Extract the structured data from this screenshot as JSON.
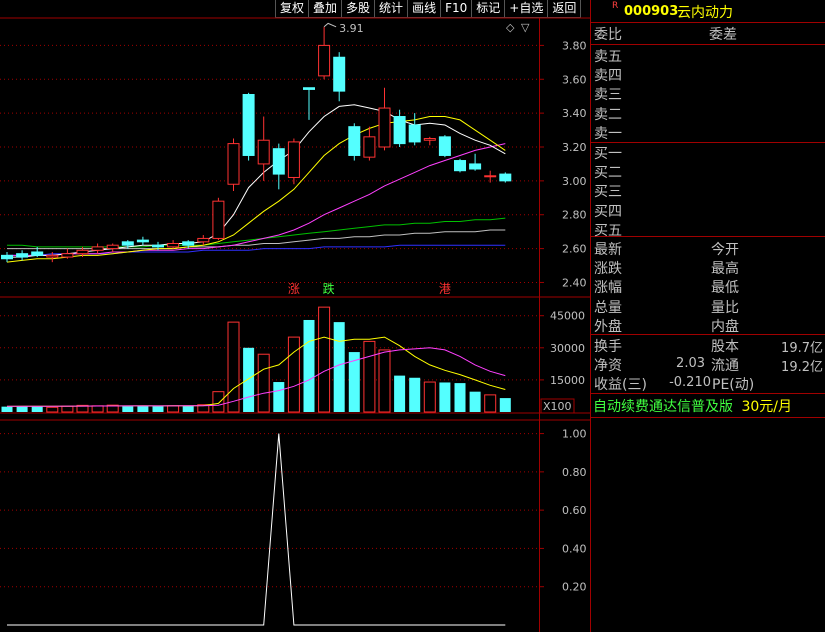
{
  "toolbar": {
    "buttons": [
      "复权",
      "叠加",
      "多股",
      "统计",
      "画线",
      "F10",
      "标记",
      "+自选",
      "返回"
    ]
  },
  "stock": {
    "marker": "R",
    "code": "000903",
    "name": "云内动力"
  },
  "order_book": {
    "committee_ratio": "委比",
    "committee_diff": "委差",
    "sell_levels": [
      "卖五",
      "卖四",
      "卖三",
      "卖二",
      "卖一"
    ],
    "buy_levels": [
      "买一",
      "买二",
      "买三",
      "买四",
      "买五"
    ]
  },
  "quote": {
    "left": [
      "最新",
      "涨跌",
      "涨幅",
      "总量",
      "外盘"
    ],
    "right": [
      "今开",
      "最高",
      "最低",
      "量比",
      "内盘"
    ]
  },
  "fundamentals": {
    "turnover_label": "换手",
    "share_capital_label": "股本",
    "share_capital_value": "19.7亿",
    "net_assets_label": "净资",
    "net_assets_value": "2.03",
    "float_label": "流通",
    "float_value": "19.2亿",
    "eps_label": "收益(三)",
    "eps_value": "-0.210",
    "pe_label": "PE(动)"
  },
  "ad": {
    "text": "自动续费通达信普及版",
    "price": "30元/月"
  },
  "chart_data": [
    {
      "type": "candlestick",
      "y_ticks": [
        "3.80",
        "3.60",
        "3.40",
        "3.20",
        "3.00",
        "2.80",
        "2.60",
        "2.40"
      ],
      "ylim": [
        2.32,
        3.95
      ],
      "max_label": "3.91",
      "event_labels": [
        "涨",
        "跌",
        "港"
      ],
      "candles": [
        {
          "o": 2.56,
          "h": 2.58,
          "l": 2.52,
          "c": 2.54,
          "up": false
        },
        {
          "o": 2.55,
          "h": 2.59,
          "l": 2.53,
          "c": 2.57,
          "up": false
        },
        {
          "o": 2.58,
          "h": 2.61,
          "l": 2.55,
          "c": 2.56,
          "up": false
        },
        {
          "o": 2.56,
          "h": 2.58,
          "l": 2.52,
          "c": 2.55,
          "up": true
        },
        {
          "o": 2.55,
          "h": 2.6,
          "l": 2.54,
          "c": 2.57,
          "up": true
        },
        {
          "o": 2.57,
          "h": 2.61,
          "l": 2.55,
          "c": 2.59,
          "up": true
        },
        {
          "o": 2.59,
          "h": 2.63,
          "l": 2.57,
          "c": 2.61,
          "up": true
        },
        {
          "o": 2.6,
          "h": 2.63,
          "l": 2.58,
          "c": 2.62,
          "up": true
        },
        {
          "o": 2.62,
          "h": 2.65,
          "l": 2.6,
          "c": 2.64,
          "up": false
        },
        {
          "o": 2.64,
          "h": 2.67,
          "l": 2.62,
          "c": 2.65,
          "up": false
        },
        {
          "o": 2.62,
          "h": 2.64,
          "l": 2.59,
          "c": 2.61,
          "up": false
        },
        {
          "o": 2.61,
          "h": 2.65,
          "l": 2.6,
          "c": 2.63,
          "up": true
        },
        {
          "o": 2.62,
          "h": 2.65,
          "l": 2.6,
          "c": 2.64,
          "up": false
        },
        {
          "o": 2.64,
          "h": 2.68,
          "l": 2.62,
          "c": 2.66,
          "up": true
        },
        {
          "o": 2.66,
          "h": 2.9,
          "l": 2.65,
          "c": 2.88,
          "up": true
        },
        {
          "o": 2.98,
          "h": 3.25,
          "l": 2.94,
          "c": 3.22,
          "up": true
        },
        {
          "o": 3.15,
          "h": 3.52,
          "l": 3.12,
          "c": 3.51,
          "up": false
        },
        {
          "o": 3.1,
          "h": 3.38,
          "l": 3.0,
          "c": 3.24,
          "up": true
        },
        {
          "o": 3.04,
          "h": 3.22,
          "l": 2.95,
          "c": 3.19,
          "up": false
        },
        {
          "o": 3.02,
          "h": 3.25,
          "l": 2.98,
          "c": 3.23,
          "up": true
        },
        {
          "o": 3.55,
          "h": 3.55,
          "l": 3.36,
          "c": 3.54,
          "up": false
        },
        {
          "o": 3.62,
          "h": 3.91,
          "l": 3.6,
          "c": 3.8,
          "up": true
        },
        {
          "o": 3.73,
          "h": 3.76,
          "l": 3.47,
          "c": 3.53,
          "up": false
        },
        {
          "o": 3.32,
          "h": 3.34,
          "l": 3.12,
          "c": 3.15,
          "up": false
        },
        {
          "o": 3.14,
          "h": 3.32,
          "l": 3.12,
          "c": 3.26,
          "up": true
        },
        {
          "o": 3.2,
          "h": 3.55,
          "l": 3.18,
          "c": 3.43,
          "up": true
        },
        {
          "o": 3.38,
          "h": 3.42,
          "l": 3.2,
          "c": 3.22,
          "up": false
        },
        {
          "o": 3.33,
          "h": 3.4,
          "l": 3.21,
          "c": 3.23,
          "up": false
        },
        {
          "o": 3.24,
          "h": 3.26,
          "l": 3.21,
          "c": 3.25,
          "up": true
        },
        {
          "o": 3.26,
          "h": 3.27,
          "l": 3.14,
          "c": 3.15,
          "up": false
        },
        {
          "o": 3.12,
          "h": 3.13,
          "l": 3.05,
          "c": 3.06,
          "up": false
        },
        {
          "o": 3.1,
          "h": 3.16,
          "l": 3.06,
          "c": 3.07,
          "up": false
        },
        {
          "o": 3.03,
          "h": 3.06,
          "l": 2.99,
          "c": 3.03,
          "up": true
        },
        {
          "o": 3.04,
          "h": 3.05,
          "l": 2.99,
          "c": 3.0,
          "up": false
        }
      ],
      "ma_white": [
        2.55,
        2.55,
        2.56,
        2.56,
        2.57,
        2.58,
        2.59,
        2.6,
        2.61,
        2.62,
        2.62,
        2.63,
        2.63,
        2.64,
        2.69,
        2.8,
        2.96,
        3.05,
        3.12,
        3.18,
        3.29,
        3.38,
        3.44,
        3.45,
        3.43,
        3.41,
        3.36,
        3.33,
        3.34,
        3.33,
        3.28,
        3.24,
        3.21,
        3.16
      ],
      "ma_yellow": [
        2.52,
        2.53,
        2.54,
        2.54,
        2.55,
        2.56,
        2.56,
        2.57,
        2.58,
        2.59,
        2.6,
        2.6,
        2.61,
        2.62,
        2.64,
        2.68,
        2.75,
        2.82,
        2.88,
        2.95,
        3.05,
        3.15,
        3.22,
        3.27,
        3.31,
        3.34,
        3.35,
        3.36,
        3.38,
        3.38,
        3.36,
        3.3,
        3.24,
        3.18
      ],
      "ma_magenta": [
        2.56,
        2.56,
        2.56,
        2.56,
        2.57,
        2.57,
        2.57,
        2.58,
        2.58,
        2.59,
        2.59,
        2.59,
        2.6,
        2.6,
        2.61,
        2.62,
        2.64,
        2.66,
        2.68,
        2.71,
        2.75,
        2.8,
        2.84,
        2.88,
        2.92,
        2.97,
        3.01,
        3.05,
        3.09,
        3.12,
        3.15,
        3.18,
        3.2,
        3.22
      ],
      "ma_green": [
        2.62,
        2.62,
        2.61,
        2.61,
        2.61,
        2.61,
        2.61,
        2.61,
        2.61,
        2.61,
        2.62,
        2.62,
        2.62,
        2.62,
        2.63,
        2.64,
        2.65,
        2.66,
        2.67,
        2.68,
        2.69,
        2.7,
        2.71,
        2.72,
        2.73,
        2.74,
        2.74,
        2.75,
        2.75,
        2.76,
        2.76,
        2.77,
        2.77,
        2.78
      ],
      "ma_gray": [
        2.6,
        2.6,
        2.6,
        2.6,
        2.6,
        2.6,
        2.6,
        2.6,
        2.6,
        2.6,
        2.6,
        2.6,
        2.61,
        2.61,
        2.61,
        2.62,
        2.62,
        2.63,
        2.63,
        2.64,
        2.65,
        2.66,
        2.66,
        2.67,
        2.67,
        2.68,
        2.68,
        2.69,
        2.69,
        2.7,
        2.7,
        2.7,
        2.71,
        2.71
      ],
      "ma_blue": [
        2.56,
        2.56,
        2.56,
        2.57,
        2.57,
        2.57,
        2.57,
        2.57,
        2.58,
        2.58,
        2.58,
        2.58,
        2.58,
        2.59,
        2.59,
        2.59,
        2.59,
        2.6,
        2.6,
        2.6,
        2.6,
        2.61,
        2.61,
        2.61,
        2.61,
        2.61,
        2.62,
        2.62,
        2.62,
        2.62,
        2.62,
        2.62,
        2.62,
        2.62
      ]
    },
    {
      "type": "bar",
      "y_ticks": [
        "45000",
        "30000",
        "15000"
      ],
      "ylim": [
        0,
        50000
      ],
      "unit": "X100",
      "volumes": [
        2500,
        2800,
        2600,
        2200,
        2700,
        3100,
        2900,
        3200,
        2600,
        3000,
        2700,
        2900,
        2800,
        3400,
        9500,
        42000,
        30000,
        27000,
        14000,
        35000,
        43000,
        49000,
        42000,
        28000,
        33000,
        29000,
        17000,
        16000,
        14000,
        13800,
        13500,
        9500,
        8000,
        6500
      ],
      "vol_ma_yellow": [
        2600,
        2650,
        2700,
        2650,
        2700,
        2750,
        2800,
        2850,
        2850,
        2900,
        2850,
        2900,
        2900,
        3000,
        4000,
        11000,
        15500,
        20000,
        22000,
        28000,
        33000,
        35000,
        33000,
        34000,
        34000,
        35000,
        31000,
        26000,
        22000,
        19500,
        17500,
        15000,
        12500,
        10500
      ],
      "vol_ma_magenta": [
        2700,
        2700,
        2700,
        2700,
        2750,
        2750,
        2800,
        2800,
        2850,
        2850,
        2850,
        2850,
        2900,
        2900,
        3200,
        5000,
        7000,
        8800,
        10000,
        12000,
        15000,
        19000,
        22000,
        24000,
        26000,
        28000,
        29000,
        29500,
        30000,
        29000,
        26000,
        22000,
        19000,
        17000
      ]
    },
    {
      "type": "line",
      "y_ticks": [
        "1.00",
        "0.80",
        "0.60",
        "0.40",
        "0.20"
      ],
      "ylim": [
        0,
        1.05
      ],
      "values": [
        0,
        0,
        0,
        0,
        0,
        0,
        0,
        0,
        0,
        0,
        0,
        0,
        0,
        0,
        0,
        0,
        0,
        0,
        1,
        0,
        0,
        0,
        0,
        0,
        0,
        0,
        0,
        0,
        0,
        0,
        0,
        0,
        0,
        0
      ]
    }
  ]
}
